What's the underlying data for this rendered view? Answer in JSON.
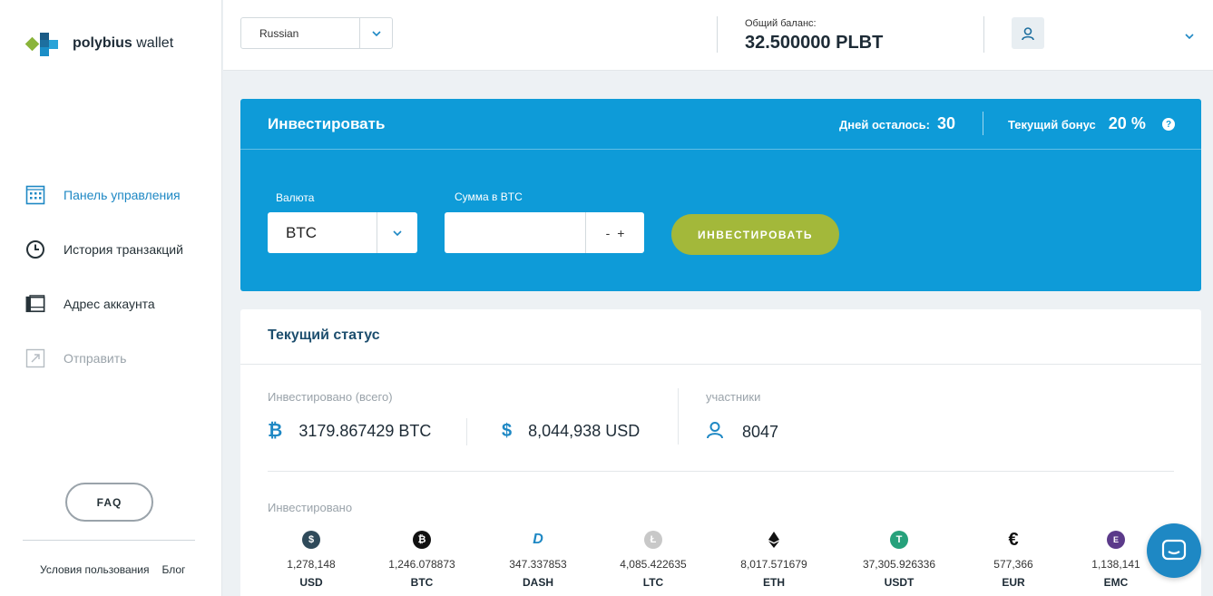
{
  "brand": {
    "bold": "polybius",
    "light": "wallet"
  },
  "sidebar": {
    "items": [
      {
        "label": "Панель управления",
        "icon": "calculator-icon"
      },
      {
        "label": "История транзакций",
        "icon": "clock-icon"
      },
      {
        "label": "Адрес аккаунта",
        "icon": "wallet-icon"
      },
      {
        "label": "Отправить",
        "icon": "send-arrow-icon"
      }
    ],
    "faq": "FAQ",
    "links": [
      "Условия пользования",
      "Блог"
    ]
  },
  "header": {
    "language": "Russian",
    "balance_label": "Общий баланс:",
    "balance_value": "32.500000 PLBT"
  },
  "invest": {
    "title": "Инвестировать",
    "days_label": "Дней осталось:",
    "days_value": "30",
    "bonus_label": "Текущий бонус",
    "bonus_value": "20 %",
    "help": "?",
    "currency_label": "Валюта",
    "currency_value": "BTC",
    "amount_label": "Сумма в BTC",
    "amount_value": "",
    "minus": "-",
    "plus": "+",
    "button": "ИНВЕСТИРОВАТЬ"
  },
  "status": {
    "title": "Текущий статус",
    "invested_total_label": "Инвестировано (всего)",
    "btc_total": "3179.867429 BTC",
    "usd_total": "8,044,938 USD",
    "participants_label": "участники",
    "participants_value": "8047",
    "invested_label": "Инвестировано",
    "coins": [
      {
        "amount": "1,278,148",
        "code": "USD",
        "icon": "dollar-icon",
        "color": "#2f4a5a"
      },
      {
        "amount": "1,246.078873",
        "code": "BTC",
        "icon": "bitcoin-icon",
        "color": "#111111"
      },
      {
        "amount": "347.337853",
        "code": "DASH",
        "icon": "dash-icon",
        "color": "#1e88c4"
      },
      {
        "amount": "4,085.422635",
        "code": "LTC",
        "icon": "litecoin-icon",
        "color": "#c8c8c8"
      },
      {
        "amount": "8,017.571679",
        "code": "ETH",
        "icon": "ethereum-icon",
        "color": "#111111"
      },
      {
        "amount": "37,305.926336",
        "code": "USDT",
        "icon": "tether-icon",
        "color": "#26a17b"
      },
      {
        "amount": "577,366",
        "code": "EUR",
        "icon": "euro-icon",
        "color": "#111111"
      },
      {
        "amount": "1,138,141",
        "code": "EMC",
        "icon": "emercoin-icon",
        "color": "#5b3a8a"
      }
    ]
  },
  "colors": {
    "accent": "#0e9bd8",
    "button": "#a3b83a",
    "link_active": "#1e88c4"
  }
}
